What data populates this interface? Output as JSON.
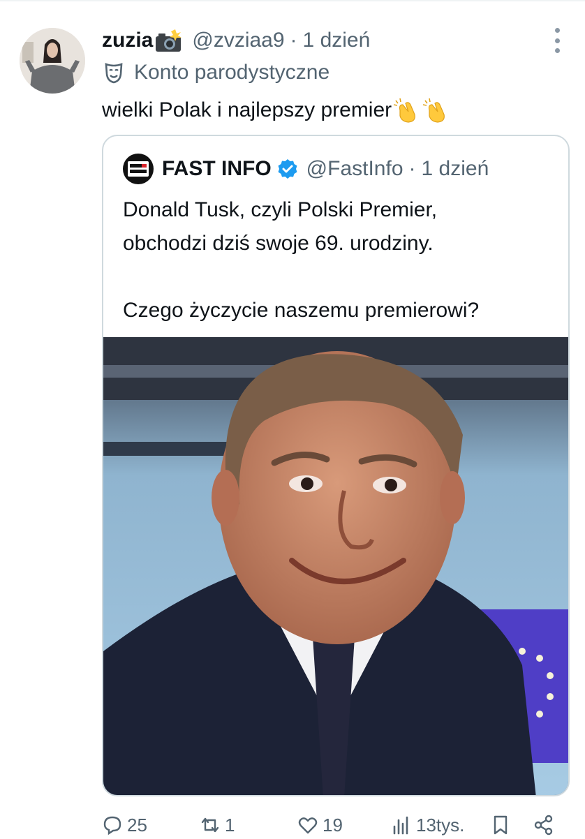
{
  "post": {
    "display_name": "zuzia",
    "handle": "@zvziaa9",
    "dot": "·",
    "time": "1 dzień",
    "parody_label": "Konto parodystyczne",
    "text": "wielki Polak i najlepszy premier",
    "icons": [
      "camera-flash-emoji",
      "parody-mask-icon",
      "clapping-hands-emoji",
      "more-icon"
    ]
  },
  "quote": {
    "display_name": "FAST INFO",
    "handle": "@FastInfo",
    "dot": "·",
    "time": "1 dzień",
    "line1": "Donald Tusk, czyli Polski Premier,",
    "line2": "obchodzi dziś swoje 69. urodziny.",
    "line3": "Czego życzycie naszemu premierowi?",
    "verified_color": "#1d9bf0"
  },
  "actions": {
    "replies": "25",
    "reposts": "1",
    "likes": "19",
    "views": "13tys."
  },
  "colors": {
    "text_primary": "#0f1419",
    "text_secondary": "#536471",
    "border": "#cfd9de"
  }
}
